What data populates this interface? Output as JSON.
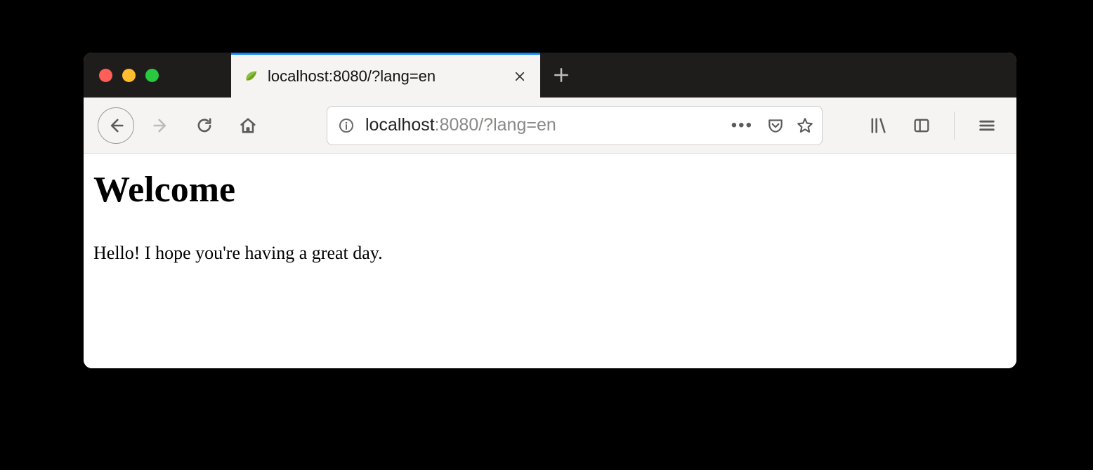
{
  "tab": {
    "title": "localhost:8080/?lang=en",
    "favicon": "spring-leaf-icon"
  },
  "url": {
    "host": "localhost",
    "port_path": ":8080/?lang=en",
    "full": "localhost:8080/?lang=en"
  },
  "page": {
    "heading": "Welcome",
    "greeting": "Hello! I hope you're having a great day."
  }
}
